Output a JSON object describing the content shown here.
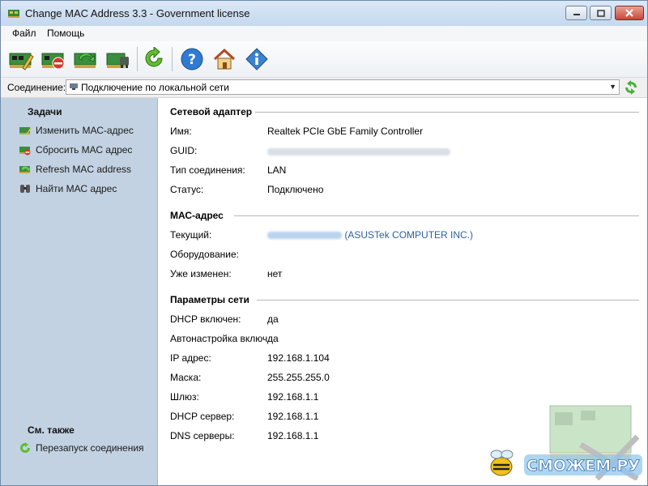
{
  "window": {
    "title": "Change MAC Address 3.3 - Government license"
  },
  "menu": {
    "items": [
      "Файл",
      "Помощь"
    ]
  },
  "connection": {
    "label": "Соединение:",
    "value": "Подключение по локальной сети"
  },
  "left": {
    "tasks_header": "Задачи",
    "tasks": [
      {
        "label": "Изменить МАС-адрес",
        "icon": "nic-edit-icon"
      },
      {
        "label": "Сбросить МАС адрес",
        "icon": "nic-reset-icon"
      },
      {
        "label": "Refresh MAC address",
        "icon": "nic-refresh-icon"
      },
      {
        "label": "Найти МАС адрес",
        "icon": "binoculars-icon"
      }
    ],
    "see_also_header": "См. также",
    "see_also": [
      {
        "label": "Перезапуск соединения",
        "icon": "restart-icon"
      }
    ]
  },
  "adapter": {
    "title": "Сетевой адаптер",
    "name_label": "Имя:",
    "name_value": "Realtek PCIe GbE Family Controller",
    "guid_label": "GUID:",
    "type_label": "Тип соединения:",
    "type_value": "LAN",
    "status_label": "Статус:",
    "status_value": "Подключено"
  },
  "mac": {
    "title": "МАС-адрес",
    "current_label": "Текущий:",
    "current_vendor": "(ASUSTek COMPUTER INC.)",
    "hardware_label": "Оборудование:",
    "changed_label": "Уже изменен:",
    "changed_value": "нет"
  },
  "network": {
    "title": "Параметры сети",
    "rows": [
      {
        "label": "DHCP включен:",
        "value": "да"
      },
      {
        "label": "Автонастройка включ.:",
        "value": "да"
      },
      {
        "label": "IP адрес:",
        "value": "192.168.1.104"
      },
      {
        "label": "Маска:",
        "value": "255.255.255.0"
      },
      {
        "label": "Шлюз:",
        "value": "192.168.1.1"
      },
      {
        "label": "DHCP сервер:",
        "value": "192.168.1.1"
      },
      {
        "label": "DNS серверы:",
        "value": "192.168.1.1"
      }
    ]
  },
  "watermark": {
    "text": "СМОЖЕМ.РУ"
  },
  "colors": {
    "left_pane": "#c3d2e2",
    "vendor_link": "#2c5f9e",
    "title_bar": "#dbe8f6"
  }
}
